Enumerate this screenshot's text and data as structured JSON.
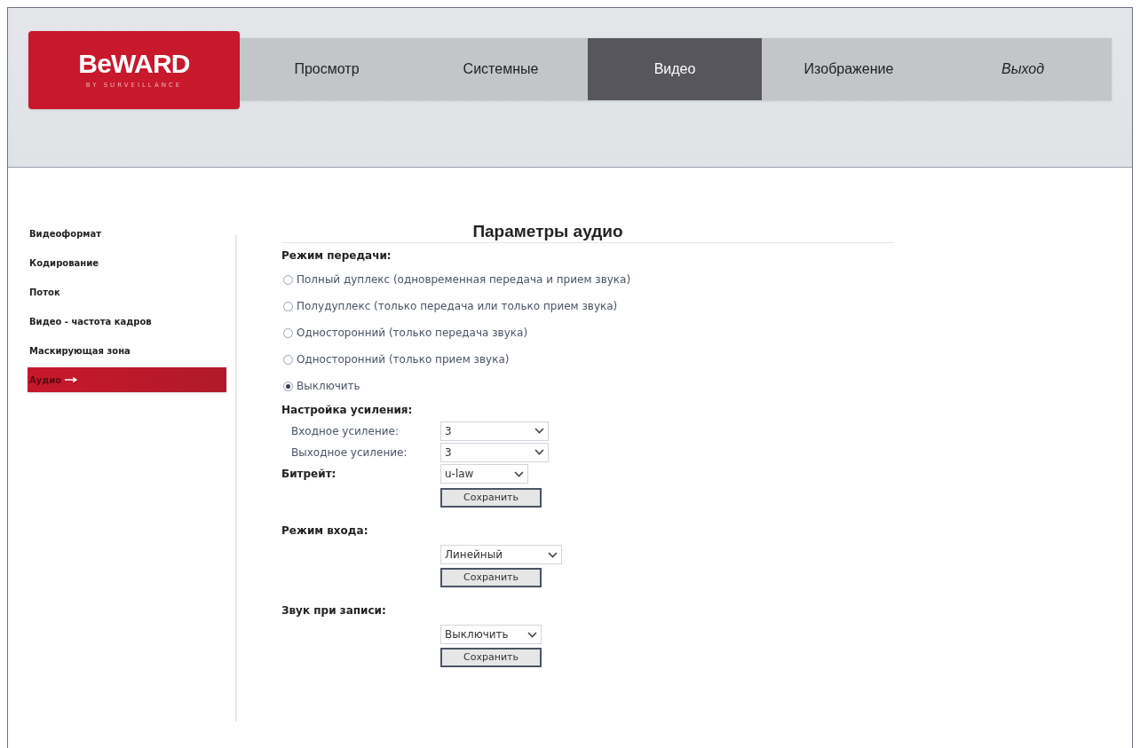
{
  "logo": {
    "brand": "BeWARD",
    "tagline": "BY SURVEILLANCE"
  },
  "tabs": [
    {
      "label": "Просмотр",
      "selected": false,
      "italic": false
    },
    {
      "label": "Системные",
      "selected": false,
      "italic": false
    },
    {
      "label": "Видео",
      "selected": true,
      "italic": false
    },
    {
      "label": "Изображение",
      "selected": false,
      "italic": false
    },
    {
      "label": "Выход",
      "selected": false,
      "italic": true
    }
  ],
  "sidebar": {
    "items": [
      {
        "label": "Видеоформат",
        "selected": false
      },
      {
        "label": "Кодирование",
        "selected": false
      },
      {
        "label": "Поток",
        "selected": false
      },
      {
        "label": "Видео - частота кадров",
        "selected": false
      },
      {
        "label": "Маскирующая зона",
        "selected": false
      },
      {
        "label": "Аудио",
        "selected": true
      }
    ]
  },
  "title": "Параметры аудио",
  "transfer_mode": {
    "label": "Режим передачи:",
    "options": [
      {
        "label": "Полный дуплекс (одновременная передача и прием звука)",
        "selected": false
      },
      {
        "label": "Полудуплекс (только передача или только прием звука)",
        "selected": false
      },
      {
        "label": "Односторонний (только передача звука)",
        "selected": false
      },
      {
        "label": "Односторонний (только прием звука)",
        "selected": false
      },
      {
        "label": "Выключить",
        "selected": true
      }
    ]
  },
  "gain": {
    "label": "Настройка усиления:",
    "fields": [
      {
        "label": "Входное усиление:",
        "value": "3"
      },
      {
        "label": "Выходное усиление:",
        "value": "3"
      }
    ]
  },
  "sections": [
    {
      "label": "Битрейт:",
      "value": "u-law",
      "button": "Сохранить",
      "inline": true
    },
    {
      "label": "Режим входа:",
      "value": "Линейный",
      "button": "Сохранить",
      "inline": false
    },
    {
      "label": "Звук при записи:",
      "value": "Выключить",
      "button": "Сохранить",
      "inline": false
    }
  ]
}
